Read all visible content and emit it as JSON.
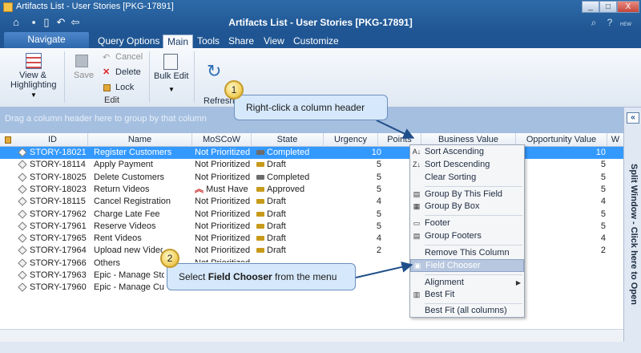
{
  "window": {
    "app_title": "Artifacts List - User Stories [PKG-17891]",
    "title": "Artifacts List - User Stories [PKG-17891]",
    "controls": [
      "_",
      "□",
      "X"
    ],
    "top_right": {
      "search": "⌕",
      "help": "?",
      "hew": "HEW"
    }
  },
  "ribbon_tabs": {
    "navigate": "Navigate",
    "tabs": [
      "Query Options",
      "Main",
      "Tools",
      "Share",
      "View",
      "Customize"
    ]
  },
  "ribbon": {
    "view_highlighting": "View &\nHighlighting",
    "save": "Save",
    "cancel": "Cancel",
    "delete": "Delete",
    "lock": "Lock",
    "edit_group": "Edit",
    "bulk_edit": "Bulk Edit",
    "refresh": "Refresh"
  },
  "grid": {
    "group_hint": "Drag a column header here to group by that column",
    "columns": [
      "ID",
      "Name",
      "MoSCoW",
      "State",
      "Urgency",
      "Points",
      "Business Value",
      "Opportunity Value",
      "W"
    ],
    "rows": [
      {
        "id": "STORY-18021",
        "name": "Register Customers",
        "moscow": "Not Prioritized",
        "state": "Completed",
        "urgency": "10",
        "bv": "",
        "ov": "10"
      },
      {
        "id": "STORY-18114",
        "name": "Apply Payment",
        "moscow": "Not Prioritized",
        "state": "Draft",
        "urgency": "5",
        "bv": "",
        "ov": "5"
      },
      {
        "id": "STORY-18025",
        "name": "Delete Customers",
        "moscow": "Not Prioritized",
        "state": "Completed",
        "urgency": "5",
        "bv": "",
        "ov": "5"
      },
      {
        "id": "STORY-18023",
        "name": "Return Videos",
        "moscow": "Must Have",
        "state": "Approved",
        "urgency": "5",
        "bv": "",
        "ov": "5"
      },
      {
        "id": "STORY-18115",
        "name": "Cancel Registration",
        "moscow": "Not Prioritized",
        "state": "Draft",
        "urgency": "4",
        "bv": "",
        "ov": "4"
      },
      {
        "id": "STORY-17962",
        "name": "Charge Late Fee",
        "moscow": "Not Prioritized",
        "state": "Draft",
        "urgency": "5",
        "bv": "",
        "ov": "5"
      },
      {
        "id": "STORY-17961",
        "name": "Reserve Videos",
        "moscow": "Not Prioritized",
        "state": "Draft",
        "urgency": "5",
        "bv": "",
        "ov": "5"
      },
      {
        "id": "STORY-17965",
        "name": "Rent Videos",
        "moscow": "Not Prioritized",
        "state": "Draft",
        "urgency": "4",
        "bv": "",
        "ov": "4"
      },
      {
        "id": "STORY-17964",
        "name": "Upload new Videos",
        "moscow": "Not Prioritized",
        "state": "Draft",
        "urgency": "2",
        "bv": "",
        "ov": "2"
      },
      {
        "id": "STORY-17966",
        "name": "Others",
        "moscow": "Not Prioritized",
        "state": "",
        "urgency": "",
        "bv": "",
        "ov": ""
      },
      {
        "id": "STORY-17963",
        "name": "Epic - Manage Store",
        "moscow": "",
        "state": "",
        "urgency": "",
        "bv": "",
        "ov": ""
      },
      {
        "id": "STORY-17960",
        "name": "Epic - Manage Custo",
        "moscow": "",
        "state": "",
        "urgency": "",
        "bv": "",
        "ov": ""
      }
    ]
  },
  "context_menu": {
    "items": [
      "Sort Ascending",
      "Sort Descending",
      "Clear Sorting",
      "Group By This Field",
      "Group By Box",
      "Footer",
      "Group Footers",
      "Remove This Column",
      "Field Chooser",
      "Alignment",
      "Best Fit",
      "Best Fit (all columns)"
    ],
    "highlighted": "Field Chooser"
  },
  "side_panel": {
    "text": "Split Window - Click here to Open",
    "button": "«"
  },
  "callouts": {
    "one": {
      "number": "1",
      "text": "Right-click a column header"
    },
    "two": {
      "number": "2",
      "text_prefix": "Select ",
      "text_bold": "Field Chooser",
      "text_suffix": " from the menu"
    }
  },
  "colors": {
    "title_bar": "#1f5592",
    "selection": "#3399ff",
    "group_bar": "#a5bfe0",
    "state_completed": "#6d6d6d",
    "state_draft": "#c89a1a",
    "state_approved": "#c89a1a",
    "must_have": "#cc2a2a"
  }
}
